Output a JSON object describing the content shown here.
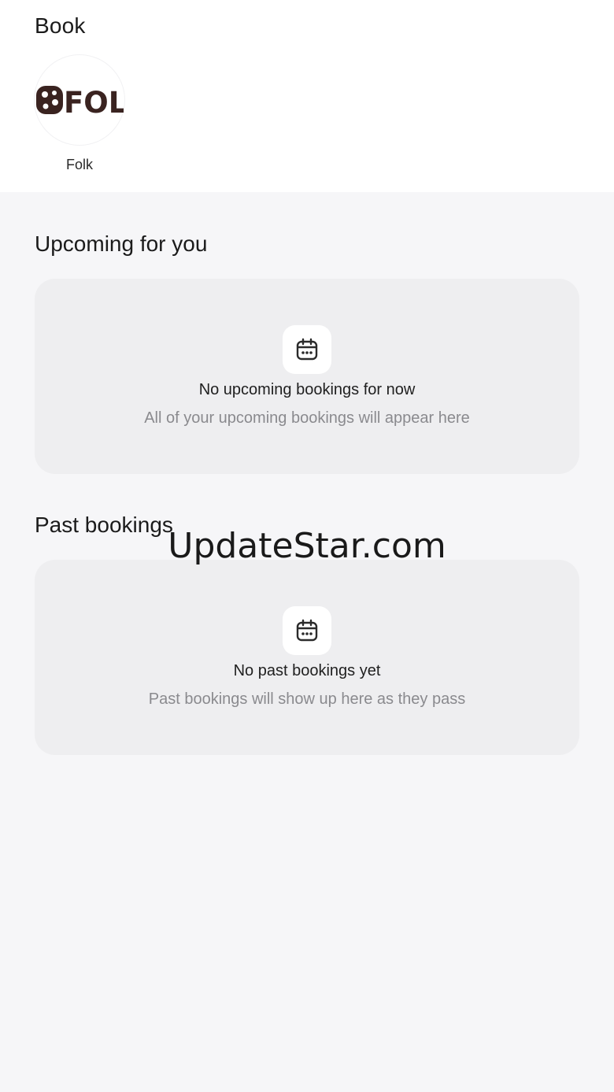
{
  "header": {
    "title": "Book"
  },
  "store": {
    "name": "Folk",
    "logo_text": "FOLK"
  },
  "upcoming": {
    "title": "Upcoming for you",
    "empty_title": "No upcoming bookings for now",
    "empty_subtitle": "All of your upcoming bookings will appear here",
    "icon": "calendar-icon"
  },
  "past": {
    "title": "Past bookings",
    "empty_title": "No past bookings yet",
    "empty_subtitle": "Past bookings will show up here as they pass",
    "icon": "calendar-icon"
  },
  "watermark": "UpdateStar.com"
}
